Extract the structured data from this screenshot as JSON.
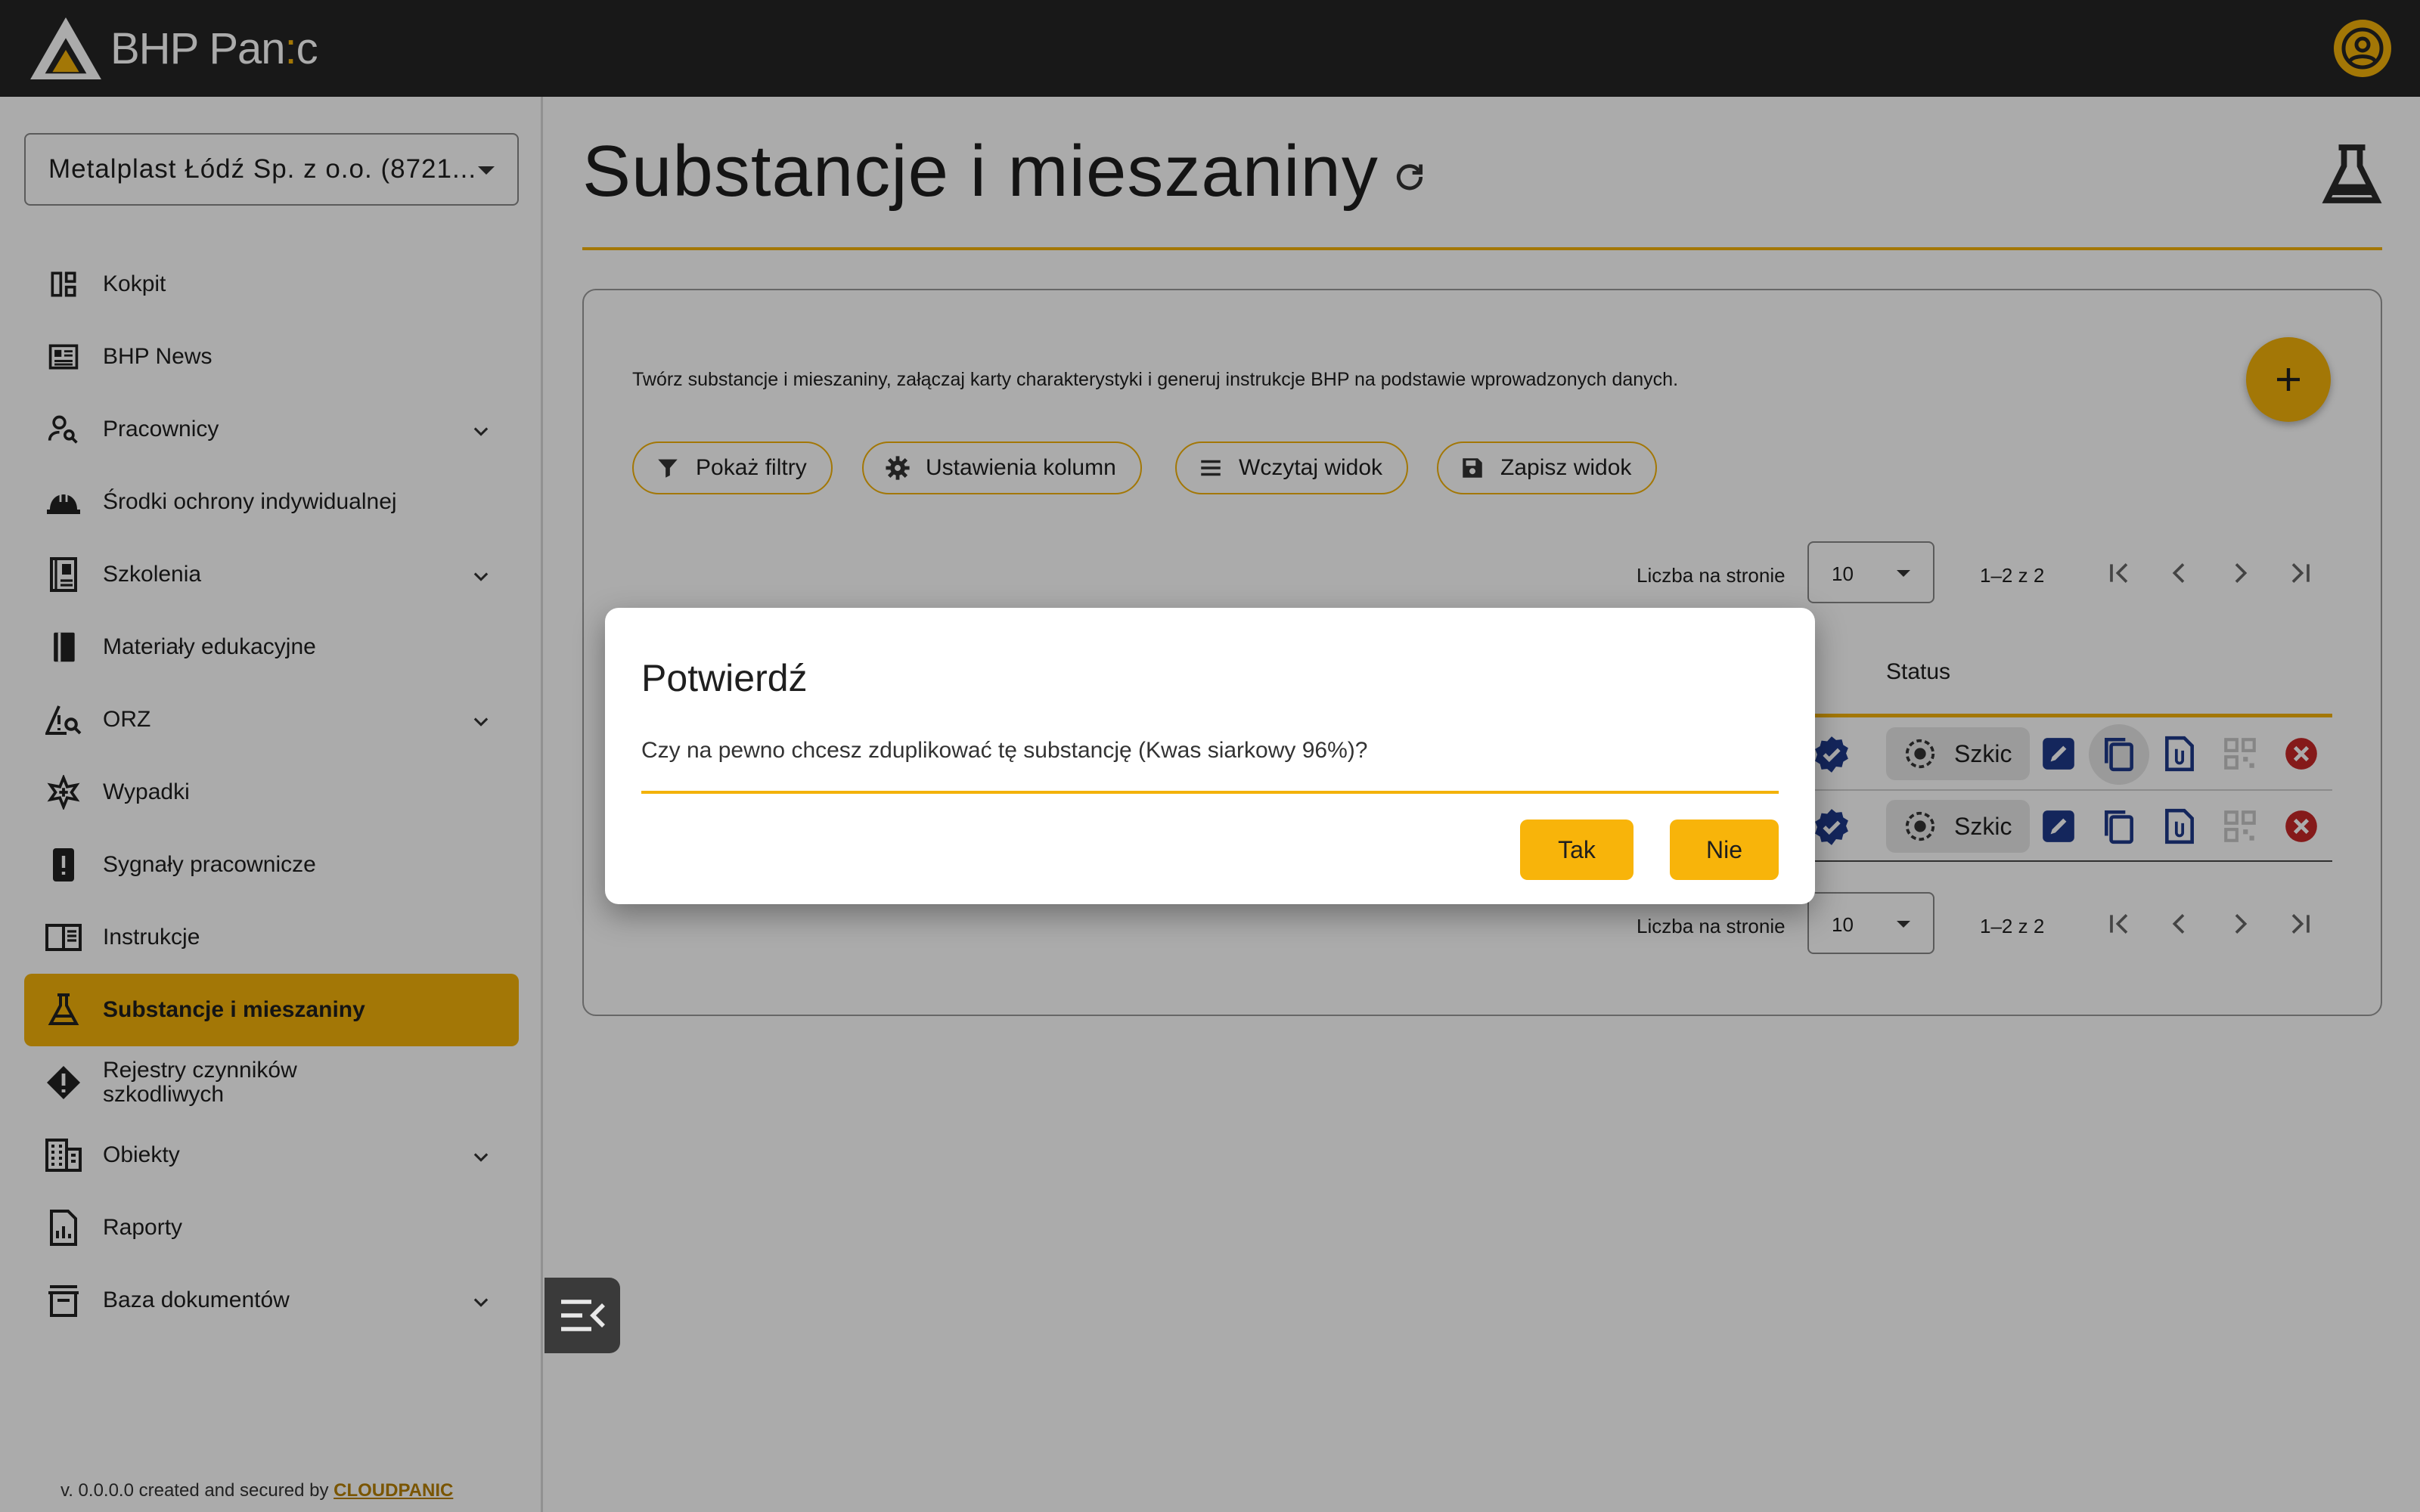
{
  "header": {
    "brand_main": "BHP Pan",
    "brand_accent": ":",
    "brand_tail": "c",
    "accent_color": "#f3b20a"
  },
  "sidebar": {
    "company": "Metalplast Łódź Sp. z o.o. (8721...",
    "items": [
      {
        "label": "Kokpit",
        "icon": "dashboard-icon",
        "expandable": false
      },
      {
        "label": "BHP News",
        "icon": "news-icon",
        "expandable": false
      },
      {
        "label": "Pracownicy",
        "icon": "person-search-icon",
        "expandable": true
      },
      {
        "label": "Środki ochrony indywidualnej",
        "icon": "helmet-icon",
        "expandable": false
      },
      {
        "label": "Szkolenia",
        "icon": "training-book-icon",
        "expandable": true
      },
      {
        "label": "Materiały edukacyjne",
        "icon": "book-icon",
        "expandable": false
      },
      {
        "label": "ORZ",
        "icon": "warning-search-icon",
        "expandable": true
      },
      {
        "label": "Wypadki",
        "icon": "medical-star-icon",
        "expandable": false
      },
      {
        "label": "Sygnały pracownicze",
        "icon": "alert-phone-icon",
        "expandable": false
      },
      {
        "label": "Instrukcje",
        "icon": "open-book-icon",
        "expandable": false
      },
      {
        "label": "Substancje i mieszaniny",
        "icon": "flask-icon",
        "expandable": false,
        "active": true
      },
      {
        "label": "Rejestry czynników szkodliwych",
        "icon": "hazard-diamond-icon",
        "expandable": false
      },
      {
        "label": "Obiekty",
        "icon": "building-icon",
        "expandable": true
      },
      {
        "label": "Raporty",
        "icon": "report-icon",
        "expandable": false
      },
      {
        "label": "Baza dokumentów",
        "icon": "archive-icon",
        "expandable": true
      }
    ],
    "version_prefix": "v. 0.0.0.0 created and secured by ",
    "version_link": "CLOUDPANIC"
  },
  "main": {
    "title": "Substancje i mieszaniny",
    "description": "Twórz substancje i mieszaniny, załączaj karty charakterystyki i generuj instrukcje BHP na podstawie wprowadzonych danych.",
    "toolbar": {
      "show_filters": "Pokaż filtry",
      "column_settings": "Ustawienia kolumn",
      "load_view": "Wczytaj widok",
      "save_view": "Zapisz widok"
    },
    "pagination": {
      "per_page_label": "Liczba na stronie",
      "per_page_value": "10",
      "range": "1–2 z 2"
    },
    "table": {
      "status_header": "Status",
      "rows": [
        {
          "status": "Szkic"
        },
        {
          "status": "Szkic"
        }
      ]
    }
  },
  "dialog": {
    "title": "Potwierdź",
    "message": "Czy na pewno chcesz zduplikować tę substancję (Kwas siarkowy 96%)?",
    "yes": "Tak",
    "no": "Nie"
  }
}
